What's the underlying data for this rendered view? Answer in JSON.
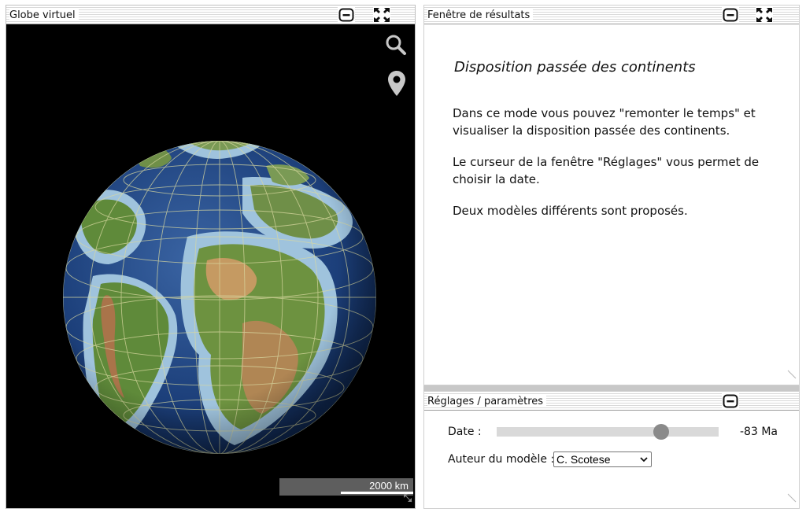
{
  "globe_panel": {
    "title": "Globe virtuel",
    "scale": {
      "label": "2000 km"
    }
  },
  "results_panel": {
    "title": "Fenêtre de résultats",
    "heading": "Disposition passée des continents",
    "paragraphs": [
      "Dans ce mode vous pouvez \"remonter le temps\" et visualiser la disposition passée des continents.",
      "Le curseur de la fenêtre \"Réglages\" vous permet de choisir la date.",
      "Deux modèles différents sont proposés."
    ]
  },
  "settings_panel": {
    "title": "Réglages / paramètres",
    "date_label": "Date :",
    "date_value": "-83 Ma",
    "slider_fraction": 0.74,
    "model_label": "Auteur du modèle :",
    "model_selected": "C. Scotese"
  },
  "icons": {
    "minimize": "minus-in-rounded-square",
    "maximize": "expand-arrows",
    "search": "magnifier",
    "location": "map-pin",
    "resize": "diagonal-resize-grip"
  },
  "colors": {
    "globe_background": "#000000",
    "ocean_deep": "#1c3f7a",
    "shelf": "#9fc3dd",
    "land_green": "#5f8a3a",
    "land_brown": "#b08654",
    "graticule": "#d8d8a0",
    "slider_track": "#d9d9d9",
    "slider_thumb": "#8a8a8a",
    "scale_bar": "#6e6e6e"
  }
}
